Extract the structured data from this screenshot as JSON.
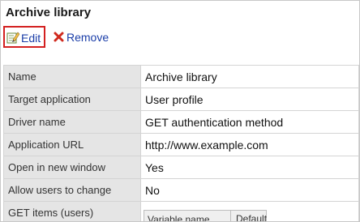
{
  "page": {
    "title": "Archive library"
  },
  "toolbar": {
    "edit_label": "Edit",
    "edit_icon": "edit-pencil-icon",
    "remove_label": "Remove",
    "remove_icon": "red-x-icon"
  },
  "colors": {
    "link": "#1a3da8",
    "highlight_border": "#d32020",
    "key_cell_bg": "#e5e5e5"
  },
  "properties": [
    {
      "key": "Name",
      "value": "Archive library"
    },
    {
      "key": "Target application",
      "value": "User profile"
    },
    {
      "key": "Driver name",
      "value": "GET authentication method"
    },
    {
      "key": "Application URL",
      "value": "http://www.example.com"
    },
    {
      "key": "Open in new window",
      "value": "Yes"
    },
    {
      "key": "Allow users to change",
      "value": "No"
    },
    {
      "key": "GET items (users)",
      "value": ""
    }
  ],
  "get_items_table": {
    "headers": [
      "Variable name",
      "Default"
    ]
  }
}
